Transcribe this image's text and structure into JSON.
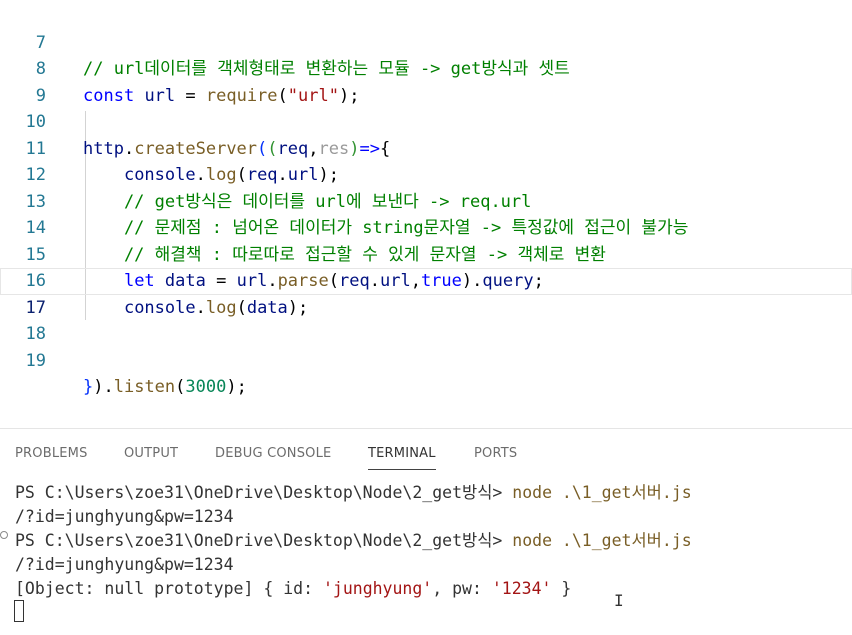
{
  "editor": {
    "lines": [
      {
        "num": "7",
        "text": "// url데이터를 객체형태로 변환하는 모듈 -> get방식과 셋트"
      },
      {
        "num": "8",
        "text": "const url = require(\"url\");"
      },
      {
        "num": "9",
        "text": ""
      },
      {
        "num": "10",
        "text": "http.createServer((req,res)=>{"
      },
      {
        "num": "11",
        "text": "    console.log(req.url);"
      },
      {
        "num": "12",
        "text": "    // get방식은 데이터를 url에 보낸다 -> req.url"
      },
      {
        "num": "13",
        "text": "    // 문제점 : 넘어온 데이터가 string문자열 -> 특정값에 접근이 불가능"
      },
      {
        "num": "14",
        "text": "    // 해결책 : 따로따로 접근할 수 있게 문자열 -> 객체로 변환"
      },
      {
        "num": "15",
        "text": "    let data = url.parse(req.url,true).query;"
      },
      {
        "num": "16",
        "text": "    console.log(data);"
      },
      {
        "num": "17",
        "text": ""
      },
      {
        "num": "18",
        "text": ""
      },
      {
        "num": "19",
        "text": "}).listen(3000);"
      }
    ]
  },
  "panel": {
    "tabs": [
      {
        "label": "PROBLEMS",
        "active": false
      },
      {
        "label": "OUTPUT",
        "active": false
      },
      {
        "label": "DEBUG CONSOLE",
        "active": false
      },
      {
        "label": "TERMINAL",
        "active": true
      },
      {
        "label": "PORTS",
        "active": false
      }
    ]
  },
  "terminal": {
    "prompt": "PS C:\\Users\\zoe31\\OneDrive\\Desktop\\Node\\2_get방식> ",
    "command": "node .\\1_get서버.js",
    "output1": "/?id=junghyung&pw=1234",
    "obj_prefix": "[Object: null prototype] { id: ",
    "obj_id": "'junghyung'",
    "obj_mid": ", pw: ",
    "obj_pw": "'1234'",
    "obj_suffix": " }"
  },
  "colors": {
    "comment": "#008000",
    "keyword": "#0000ff",
    "string": "#a31515",
    "number": "#098658",
    "function": "#795e26",
    "variable": "#001080",
    "line_number": "#237893"
  },
  "icons": {
    "mouse_cursor": "I",
    "terminal_cursor": "block-cursor"
  }
}
